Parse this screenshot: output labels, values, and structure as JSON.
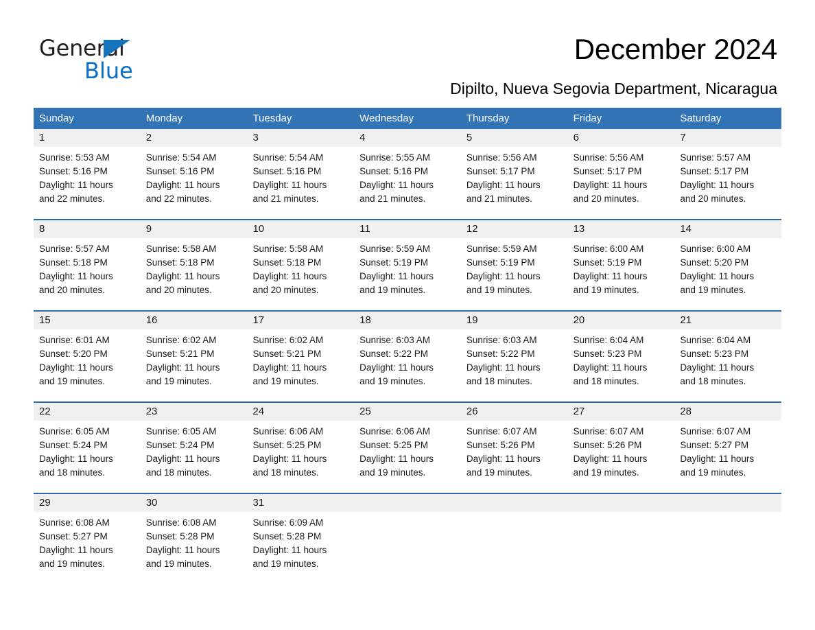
{
  "brand": {
    "name_part1": "General",
    "name_part2": "Blue",
    "triangle_color": "#1574bb",
    "blue_text_color": "#0a6fc2"
  },
  "header": {
    "title": "December 2024",
    "subtitle": "Dipilto, Nueva Segovia Department, Nicaragua"
  },
  "theme": {
    "header_bg": "#3273b5",
    "week_rule": "#2f6aa8",
    "daynum_bg": "#f0f0f0",
    "page_bg": "#ffffff"
  },
  "calendar": {
    "weekday_headers": [
      "Sunday",
      "Monday",
      "Tuesday",
      "Wednesday",
      "Thursday",
      "Friday",
      "Saturday"
    ],
    "weeks": [
      [
        {
          "day": "1",
          "sunrise": "Sunrise: 5:53 AM",
          "sunset": "Sunset: 5:16 PM",
          "daylight_line1": "Daylight: 11 hours",
          "daylight_line2": "and 22 minutes."
        },
        {
          "day": "2",
          "sunrise": "Sunrise: 5:54 AM",
          "sunset": "Sunset: 5:16 PM",
          "daylight_line1": "Daylight: 11 hours",
          "daylight_line2": "and 22 minutes."
        },
        {
          "day": "3",
          "sunrise": "Sunrise: 5:54 AM",
          "sunset": "Sunset: 5:16 PM",
          "daylight_line1": "Daylight: 11 hours",
          "daylight_line2": "and 21 minutes."
        },
        {
          "day": "4",
          "sunrise": "Sunrise: 5:55 AM",
          "sunset": "Sunset: 5:16 PM",
          "daylight_line1": "Daylight: 11 hours",
          "daylight_line2": "and 21 minutes."
        },
        {
          "day": "5",
          "sunrise": "Sunrise: 5:56 AM",
          "sunset": "Sunset: 5:17 PM",
          "daylight_line1": "Daylight: 11 hours",
          "daylight_line2": "and 21 minutes."
        },
        {
          "day": "6",
          "sunrise": "Sunrise: 5:56 AM",
          "sunset": "Sunset: 5:17 PM",
          "daylight_line1": "Daylight: 11 hours",
          "daylight_line2": "and 20 minutes."
        },
        {
          "day": "7",
          "sunrise": "Sunrise: 5:57 AM",
          "sunset": "Sunset: 5:17 PM",
          "daylight_line1": "Daylight: 11 hours",
          "daylight_line2": "and 20 minutes."
        }
      ],
      [
        {
          "day": "8",
          "sunrise": "Sunrise: 5:57 AM",
          "sunset": "Sunset: 5:18 PM",
          "daylight_line1": "Daylight: 11 hours",
          "daylight_line2": "and 20 minutes."
        },
        {
          "day": "9",
          "sunrise": "Sunrise: 5:58 AM",
          "sunset": "Sunset: 5:18 PM",
          "daylight_line1": "Daylight: 11 hours",
          "daylight_line2": "and 20 minutes."
        },
        {
          "day": "10",
          "sunrise": "Sunrise: 5:58 AM",
          "sunset": "Sunset: 5:18 PM",
          "daylight_line1": "Daylight: 11 hours",
          "daylight_line2": "and 20 minutes."
        },
        {
          "day": "11",
          "sunrise": "Sunrise: 5:59 AM",
          "sunset": "Sunset: 5:19 PM",
          "daylight_line1": "Daylight: 11 hours",
          "daylight_line2": "and 19 minutes."
        },
        {
          "day": "12",
          "sunrise": "Sunrise: 5:59 AM",
          "sunset": "Sunset: 5:19 PM",
          "daylight_line1": "Daylight: 11 hours",
          "daylight_line2": "and 19 minutes."
        },
        {
          "day": "13",
          "sunrise": "Sunrise: 6:00 AM",
          "sunset": "Sunset: 5:19 PM",
          "daylight_line1": "Daylight: 11 hours",
          "daylight_line2": "and 19 minutes."
        },
        {
          "day": "14",
          "sunrise": "Sunrise: 6:00 AM",
          "sunset": "Sunset: 5:20 PM",
          "daylight_line1": "Daylight: 11 hours",
          "daylight_line2": "and 19 minutes."
        }
      ],
      [
        {
          "day": "15",
          "sunrise": "Sunrise: 6:01 AM",
          "sunset": "Sunset: 5:20 PM",
          "daylight_line1": "Daylight: 11 hours",
          "daylight_line2": "and 19 minutes."
        },
        {
          "day": "16",
          "sunrise": "Sunrise: 6:02 AM",
          "sunset": "Sunset: 5:21 PM",
          "daylight_line1": "Daylight: 11 hours",
          "daylight_line2": "and 19 minutes."
        },
        {
          "day": "17",
          "sunrise": "Sunrise: 6:02 AM",
          "sunset": "Sunset: 5:21 PM",
          "daylight_line1": "Daylight: 11 hours",
          "daylight_line2": "and 19 minutes."
        },
        {
          "day": "18",
          "sunrise": "Sunrise: 6:03 AM",
          "sunset": "Sunset: 5:22 PM",
          "daylight_line1": "Daylight: 11 hours",
          "daylight_line2": "and 19 minutes."
        },
        {
          "day": "19",
          "sunrise": "Sunrise: 6:03 AM",
          "sunset": "Sunset: 5:22 PM",
          "daylight_line1": "Daylight: 11 hours",
          "daylight_line2": "and 18 minutes."
        },
        {
          "day": "20",
          "sunrise": "Sunrise: 6:04 AM",
          "sunset": "Sunset: 5:23 PM",
          "daylight_line1": "Daylight: 11 hours",
          "daylight_line2": "and 18 minutes."
        },
        {
          "day": "21",
          "sunrise": "Sunrise: 6:04 AM",
          "sunset": "Sunset: 5:23 PM",
          "daylight_line1": "Daylight: 11 hours",
          "daylight_line2": "and 18 minutes."
        }
      ],
      [
        {
          "day": "22",
          "sunrise": "Sunrise: 6:05 AM",
          "sunset": "Sunset: 5:24 PM",
          "daylight_line1": "Daylight: 11 hours",
          "daylight_line2": "and 18 minutes."
        },
        {
          "day": "23",
          "sunrise": "Sunrise: 6:05 AM",
          "sunset": "Sunset: 5:24 PM",
          "daylight_line1": "Daylight: 11 hours",
          "daylight_line2": "and 18 minutes."
        },
        {
          "day": "24",
          "sunrise": "Sunrise: 6:06 AM",
          "sunset": "Sunset: 5:25 PM",
          "daylight_line1": "Daylight: 11 hours",
          "daylight_line2": "and 18 minutes."
        },
        {
          "day": "25",
          "sunrise": "Sunrise: 6:06 AM",
          "sunset": "Sunset: 5:25 PM",
          "daylight_line1": "Daylight: 11 hours",
          "daylight_line2": "and 19 minutes."
        },
        {
          "day": "26",
          "sunrise": "Sunrise: 6:07 AM",
          "sunset": "Sunset: 5:26 PM",
          "daylight_line1": "Daylight: 11 hours",
          "daylight_line2": "and 19 minutes."
        },
        {
          "day": "27",
          "sunrise": "Sunrise: 6:07 AM",
          "sunset": "Sunset: 5:26 PM",
          "daylight_line1": "Daylight: 11 hours",
          "daylight_line2": "and 19 minutes."
        },
        {
          "day": "28",
          "sunrise": "Sunrise: 6:07 AM",
          "sunset": "Sunset: 5:27 PM",
          "daylight_line1": "Daylight: 11 hours",
          "daylight_line2": "and 19 minutes."
        }
      ],
      [
        {
          "day": "29",
          "sunrise": "Sunrise: 6:08 AM",
          "sunset": "Sunset: 5:27 PM",
          "daylight_line1": "Daylight: 11 hours",
          "daylight_line2": "and 19 minutes."
        },
        {
          "day": "30",
          "sunrise": "Sunrise: 6:08 AM",
          "sunset": "Sunset: 5:28 PM",
          "daylight_line1": "Daylight: 11 hours",
          "daylight_line2": "and 19 minutes."
        },
        {
          "day": "31",
          "sunrise": "Sunrise: 6:09 AM",
          "sunset": "Sunset: 5:28 PM",
          "daylight_line1": "Daylight: 11 hours",
          "daylight_line2": "and 19 minutes."
        },
        {
          "day": "",
          "sunrise": "",
          "sunset": "",
          "daylight_line1": "",
          "daylight_line2": ""
        },
        {
          "day": "",
          "sunrise": "",
          "sunset": "",
          "daylight_line1": "",
          "daylight_line2": ""
        },
        {
          "day": "",
          "sunrise": "",
          "sunset": "",
          "daylight_line1": "",
          "daylight_line2": ""
        },
        {
          "day": "",
          "sunrise": "",
          "sunset": "",
          "daylight_line1": "",
          "daylight_line2": ""
        }
      ]
    ]
  }
}
